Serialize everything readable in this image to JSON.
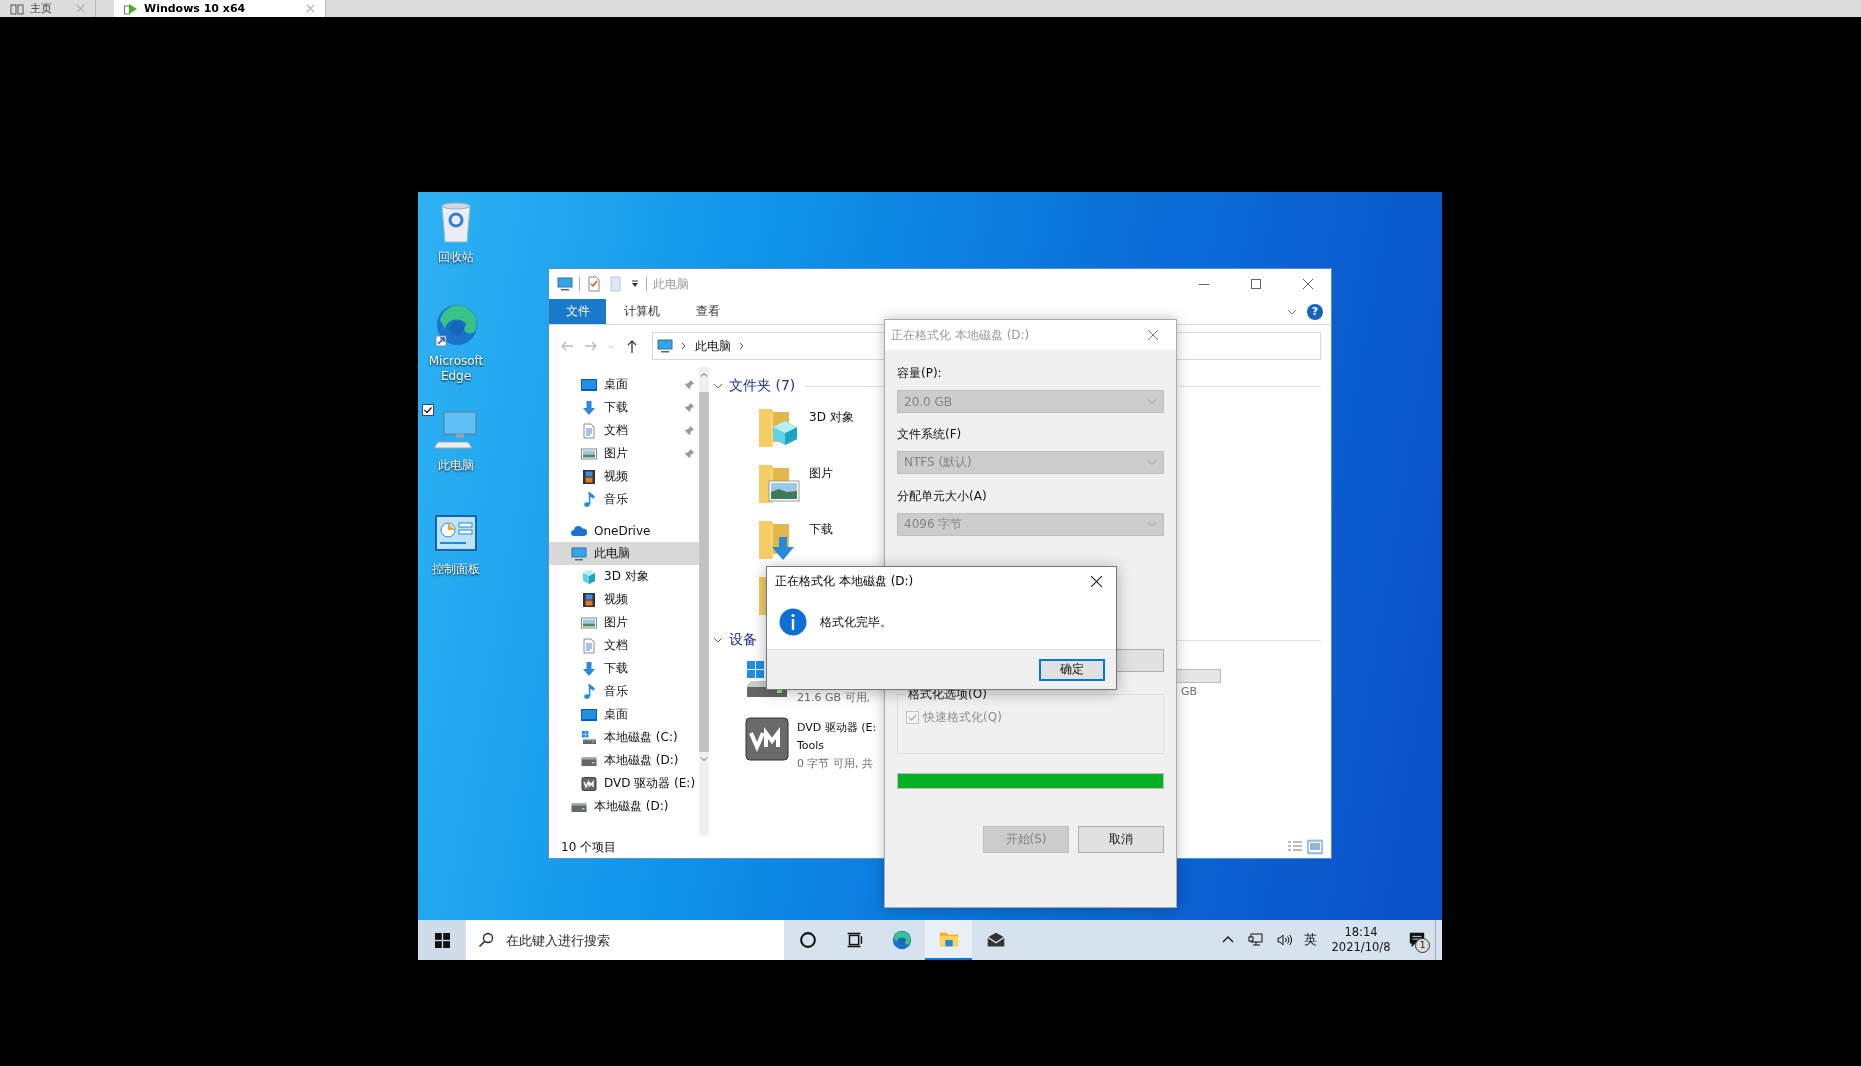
{
  "host_tabs": [
    {
      "label": "主页",
      "kind": "home",
      "selected": false
    },
    {
      "label": "Windows 10 x64",
      "kind": "vm",
      "selected": true
    }
  ],
  "desktop_icons": [
    {
      "label": "回收站",
      "kind": "recycle"
    },
    {
      "label": "Microsoft Edge",
      "kind": "edge"
    },
    {
      "label": "此电脑",
      "kind": "pc",
      "checked": true
    },
    {
      "label": "控制面板",
      "kind": "control"
    }
  ],
  "explorer": {
    "title": "此电脑",
    "help_label": "?",
    "ribbon_tabs": [
      {
        "label": "文件",
        "selected": true
      },
      {
        "label": "计算机",
        "selected": false
      },
      {
        "label": "查看",
        "selected": false
      }
    ],
    "address": [
      "此电脑"
    ],
    "quick_access": [
      {
        "label": "桌面",
        "kind": "desktop",
        "pinned": true,
        "selected": false
      },
      {
        "label": "下载",
        "kind": "download",
        "pinned": true,
        "selected": false
      },
      {
        "label": "文档",
        "kind": "document",
        "pinned": true,
        "selected": false
      },
      {
        "label": "图片",
        "kind": "picture",
        "pinned": true,
        "selected": false
      },
      {
        "label": "视频",
        "kind": "video",
        "pinned": false,
        "selected": false
      },
      {
        "label": "音乐",
        "kind": "music",
        "pinned": false,
        "selected": false
      }
    ],
    "tree": [
      {
        "label": "OneDrive",
        "kind": "onedrive",
        "selected": false
      },
      {
        "label": "此电脑",
        "kind": "pc",
        "selected": true,
        "children": [
          {
            "label": "3D 对象",
            "kind": "cube",
            "selected": false
          },
          {
            "label": "视频",
            "kind": "video",
            "selected": false
          },
          {
            "label": "图片",
            "kind": "picture",
            "selected": false
          },
          {
            "label": "文档",
            "kind": "document",
            "selected": false
          },
          {
            "label": "下载",
            "kind": "download",
            "selected": false
          },
          {
            "label": "音乐",
            "kind": "music",
            "selected": false
          },
          {
            "label": "桌面",
            "kind": "desktop",
            "selected": false
          },
          {
            "label": "本地磁盘 (C:)",
            "kind": "windows",
            "selected": false
          },
          {
            "label": "本地磁盘 (D:)",
            "kind": "drive",
            "selected": false
          },
          {
            "label": "DVD 驱动器 (E:)",
            "kind": "dvd",
            "selected": false
          }
        ]
      },
      {
        "label": "本地磁盘 (D:)",
        "kind": "drive",
        "selected": false
      }
    ],
    "groups": [
      {
        "title": "文件夹 (7)",
        "expanded": true,
        "kind": "folders",
        "items": [
          {
            "label": "3D 对象",
            "kind": "cube"
          },
          {
            "label": "图片",
            "kind": "picture"
          },
          {
            "label": "下载",
            "kind": "download"
          },
          {
            "kind": "plain"
          }
        ]
      },
      {
        "title": "设备",
        "expanded": true,
        "kind": "devices",
        "items": [
          {
            "kind": "windows",
            "lines": [
              "21.6 GB 可用,"
            ]
          },
          {
            "kind": "dvd",
            "lines": [
              "DVD 驱动器 (E:",
              "Tools",
              "0 字节 可用, 共"
            ]
          }
        ],
        "partial_size": "GB"
      }
    ],
    "status_bar": "10 个项目"
  },
  "format_dialog": {
    "title": "正在格式化 本地磁盘 (D:)",
    "active": false,
    "fields": [
      {
        "label": "容量(P):",
        "value": "20.0 GB",
        "disabled": true
      },
      {
        "label": "文件系统(F)",
        "value": "NTFS (默认)",
        "disabled": true
      },
      {
        "label": "分配单元大小(A)",
        "value": "4096 字节",
        "disabled": true
      }
    ],
    "options_label": "格式化选项(O)",
    "quick_format": {
      "label": "快速格式化(Q)",
      "checked": true,
      "disabled": true
    },
    "progress": {
      "level": 1
    },
    "buttons": [
      {
        "label": "开始(S)",
        "disabled": true
      },
      {
        "label": "取消",
        "disabled": false
      }
    ]
  },
  "message_box": {
    "title": "正在格式化 本地磁盘 (D:)",
    "message": "格式化完毕。",
    "button": "确定"
  },
  "taskbar": {
    "search_placeholder": "在此键入进行搜索",
    "apps": [
      {
        "kind": "cortana",
        "active": false
      },
      {
        "kind": "taskview",
        "active": false
      },
      {
        "kind": "edge",
        "active": false
      },
      {
        "kind": "explorer",
        "active": true
      },
      {
        "kind": "mail",
        "active": false
      }
    ],
    "ime": "英",
    "time": "18:14",
    "date": "2021/10/8",
    "notifications": "1"
  }
}
